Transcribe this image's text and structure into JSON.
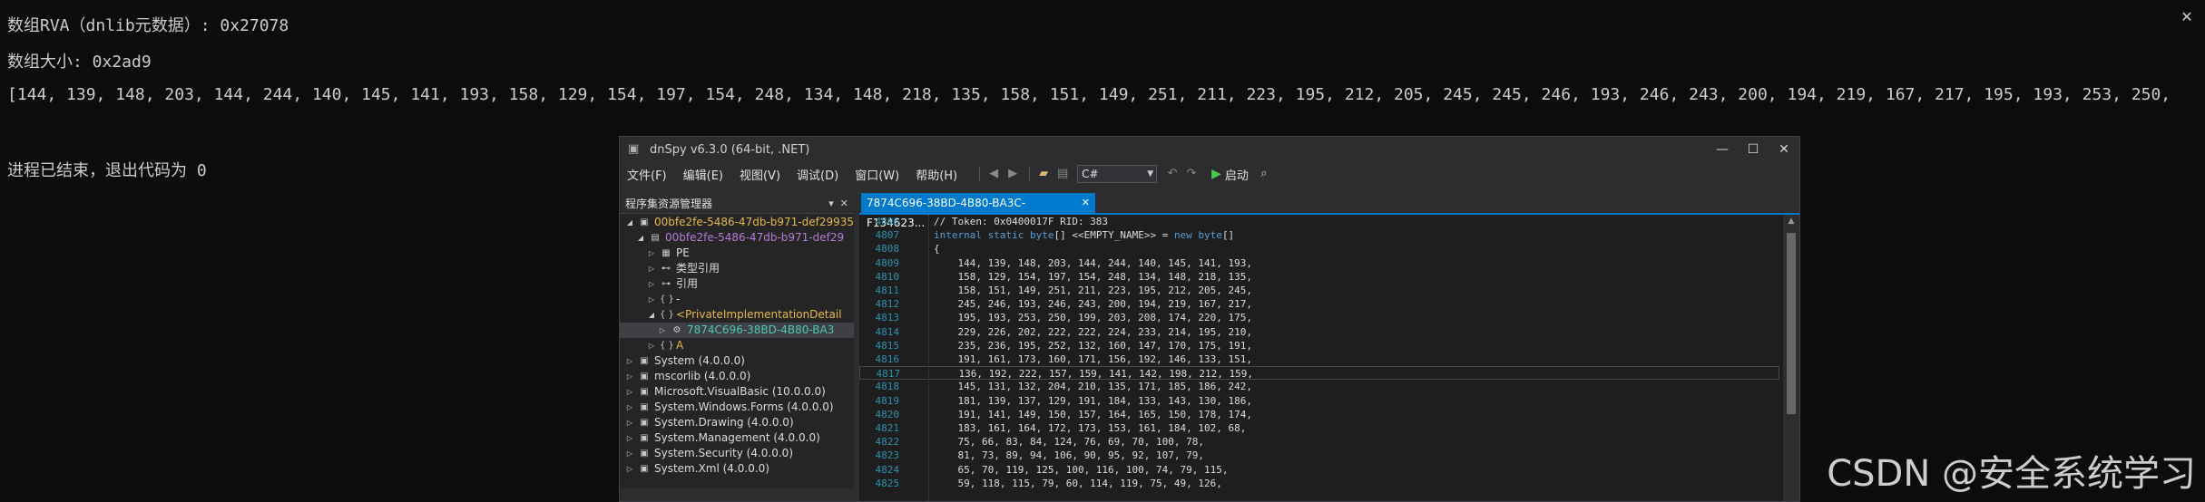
{
  "console": {
    "lines": [
      "数组RVA（dnlib元数据）: 0x27078",
      "数组大小: 0x2ad9",
      "[144, 139, 148, 203, 144, 244, 140, 145, 141, 193, 158, 129, 154, 197, 154, 248, 134, 148, 218, 135, 158, 151, 149, 251, 211, 223, 195, 212, 205, 245, 245, 246, 193, 246, 243, 200, 194, 219, 167, 217, 195, 193, 253, 250,",
      "",
      "进程已结束，退出代码为 0"
    ]
  },
  "dnspy": {
    "title": "dnSpy v6.3.0 (64-bit, .NET)",
    "menu": [
      "文件(F)",
      "编辑(E)",
      "视图(V)",
      "调试(D)",
      "窗口(W)",
      "帮助(H)"
    ],
    "language": "C#",
    "start_label": "启动",
    "explorer_title": "程序集资源管理器",
    "tree": [
      {
        "label": "00bfe2fe-5486-47db-b971-def29935",
        "depth": 0,
        "expander": "expanded",
        "icon": "assembly-icon",
        "color": "#e5b94b"
      },
      {
        "label": "00bfe2fe-5486-47db-b971-def29",
        "depth": 1,
        "expander": "expanded",
        "icon": "module-icon",
        "color": "#b57bd6"
      },
      {
        "label": "PE",
        "depth": 2,
        "expander": "collapsed",
        "icon": "pe-icon",
        "color": "#dcdcdc"
      },
      {
        "label": "类型引用",
        "depth": 2,
        "expander": "collapsed",
        "icon": "typeref-icon",
        "color": "#dcdcdc"
      },
      {
        "label": "引用",
        "depth": 2,
        "expander": "collapsed",
        "icon": "references-icon",
        "color": "#dcdcdc"
      },
      {
        "label": "-",
        "depth": 2,
        "expander": "collapsed",
        "icon": "namespace-icon",
        "color": "#dcdcdc"
      },
      {
        "label": "<PrivateImplementationDetail",
        "depth": 2,
        "expander": "expanded",
        "icon": "namespace-icon",
        "color": "#e5b94b"
      },
      {
        "label": "7874C696-38BD-4B80-BA3",
        "depth": 3,
        "expander": "collapsed",
        "icon": "class-icon",
        "color": "#4ec9b0",
        "selected": true
      },
      {
        "label": "A",
        "depth": 2,
        "expander": "collapsed",
        "icon": "namespace-icon",
        "color": "#e5b94b"
      },
      {
        "label": "System (4.0.0.0)",
        "depth": 0,
        "expander": "collapsed",
        "icon": "assembly-icon",
        "color": "#dcdcdc"
      },
      {
        "label": "mscorlib (4.0.0.0)",
        "depth": 0,
        "expander": "collapsed",
        "icon": "assembly-icon",
        "color": "#dcdcdc"
      },
      {
        "label": "Microsoft.VisualBasic (10.0.0.0)",
        "depth": 0,
        "expander": "collapsed",
        "icon": "assembly-icon",
        "color": "#dcdcdc"
      },
      {
        "label": "System.Windows.Forms (4.0.0.0)",
        "depth": 0,
        "expander": "collapsed",
        "icon": "assembly-icon",
        "color": "#dcdcdc"
      },
      {
        "label": "System.Drawing (4.0.0.0)",
        "depth": 0,
        "expander": "collapsed",
        "icon": "assembly-icon",
        "color": "#dcdcdc"
      },
      {
        "label": "System.Management (4.0.0.0)",
        "depth": 0,
        "expander": "collapsed",
        "icon": "assembly-icon",
        "color": "#dcdcdc"
      },
      {
        "label": "System.Security (4.0.0.0)",
        "depth": 0,
        "expander": "collapsed",
        "icon": "assembly-icon",
        "color": "#dcdcdc"
      },
      {
        "label": "System.Xml (4.0.0.0)",
        "depth": 0,
        "expander": "collapsed",
        "icon": "assembly-icon",
        "color": "#dcdcdc"
      }
    ],
    "tab_title": "7874C696-38BD-4B80-BA3C-F134623...",
    "code": [
      {
        "ln": "4806",
        "text": "// Token: 0x0400017F RID: 383",
        "kind": "comment"
      },
      {
        "ln": "4807",
        "text": "internal static byte[] <<EMPTY_NAME>> = new byte[]",
        "kind": "decl"
      },
      {
        "ln": "4808",
        "text": "{",
        "kind": "plain"
      },
      {
        "ln": "4809",
        "text": "    144, 139, 148, 203, 144, 244, 140, 145, 141, 193,",
        "kind": "plain"
      },
      {
        "ln": "4810",
        "text": "    158, 129, 154, 197, 154, 248, 134, 148, 218, 135,",
        "kind": "plain"
      },
      {
        "ln": "4811",
        "text": "    158, 151, 149, 251, 211, 223, 195, 212, 205, 245,",
        "kind": "plain"
      },
      {
        "ln": "4812",
        "text": "    245, 246, 193, 246, 243, 200, 194, 219, 167, 217,",
        "kind": "plain"
      },
      {
        "ln": "4813",
        "text": "    195, 193, 253, 250, 199, 203, 208, 174, 220, 175,",
        "kind": "plain"
      },
      {
        "ln": "4814",
        "text": "    229, 226, 202, 222, 222, 224, 233, 214, 195, 210,",
        "kind": "plain"
      },
      {
        "ln": "4815",
        "text": "    235, 236, 195, 252, 132, 160, 147, 170, 175, 191,",
        "kind": "plain"
      },
      {
        "ln": "4816",
        "text": "    191, 161, 173, 160, 171, 156, 192, 146, 133, 151,",
        "kind": "plain"
      },
      {
        "ln": "4817",
        "text": "    136, 192, 222, 157, 159, 141, 142, 198, 212, 159,",
        "kind": "plain",
        "current": true
      },
      {
        "ln": "4818",
        "text": "    145, 131, 132, 204, 210, 135, 171, 185, 186, 242,",
        "kind": "plain"
      },
      {
        "ln": "4819",
        "text": "    181, 139, 137, 129, 191, 184, 133, 143, 130, 186,",
        "kind": "plain"
      },
      {
        "ln": "4820",
        "text": "    191, 141, 149, 150, 157, 164, 165, 150, 178, 174,",
        "kind": "plain"
      },
      {
        "ln": "4821",
        "text": "    183, 161, 164, 172, 173, 153, 161, 184, 102, 68,",
        "kind": "plain"
      },
      {
        "ln": "4822",
        "text": "    75, 66, 83, 84, 124, 76, 69, 70, 100, 78,",
        "kind": "plain"
      },
      {
        "ln": "4823",
        "text": "    81, 73, 89, 94, 106, 90, 95, 92, 107, 79,",
        "kind": "plain"
      },
      {
        "ln": "4824",
        "text": "    65, 70, 119, 125, 100, 116, 100, 74, 79, 115,",
        "kind": "plain"
      },
      {
        "ln": "4825",
        "text": "    59, 118, 115, 79, 60, 114, 119, 75, 49, 126,",
        "kind": "plain"
      }
    ]
  },
  "watermark": "CSDN @安全系统学习"
}
